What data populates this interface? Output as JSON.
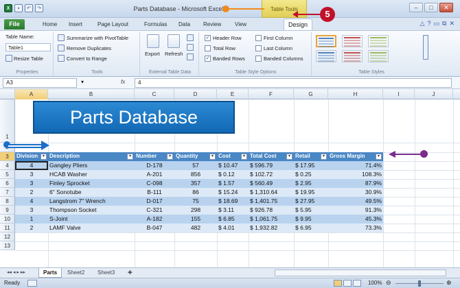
{
  "window": {
    "title": "Parts Database - Microsoft Excel",
    "contextual_tab_group": "Table Tools"
  },
  "ribbon_tabs": [
    "File",
    "Home",
    "Insert",
    "Page Layout",
    "Formulas",
    "Data",
    "Review",
    "View",
    "Design"
  ],
  "active_tab": "Design",
  "ribbon": {
    "properties": {
      "table_name_label": "Table Name:",
      "table_name_value": "Table1",
      "resize_label": "Resize Table",
      "caption": "Properties"
    },
    "tools": {
      "summarize": "Summarize with PivotTable",
      "remove_duplicates": "Remove Duplicates",
      "convert_to_range": "Convert to Range",
      "caption": "Tools"
    },
    "external": {
      "export": "Export",
      "refresh": "Refresh",
      "caption": "External Table Data"
    },
    "style_options": {
      "header_row": "Header Row",
      "total_row": "Total Row",
      "banded_rows": "Banded Rows",
      "first_column": "First Column",
      "last_column": "Last Column",
      "banded_columns": "Banded Columns",
      "caption": "Table Style Options",
      "checked": {
        "header_row": true,
        "total_row": false,
        "banded_rows": true,
        "first_column": false,
        "last_column": false,
        "banded_columns": false
      }
    },
    "table_styles": {
      "caption": "Table Styles",
      "swatch_colors": [
        "#4f81bd",
        "#c0504d",
        "#9bbb59",
        "#4f81bd",
        "#c0504d",
        "#9bbb59"
      ]
    }
  },
  "formula_bar": {
    "name_box": "A3",
    "fx": "fx",
    "value": "4"
  },
  "columns": [
    "A",
    "B",
    "C",
    "D",
    "E",
    "F",
    "G",
    "H",
    "I",
    "J"
  ],
  "rows": [
    "1",
    "2",
    "3",
    "4",
    "5",
    "6",
    "7",
    "8",
    "9",
    "10",
    "11",
    "12",
    "13"
  ],
  "banner_title": "Parts Database",
  "table": {
    "headers": [
      "Division",
      "Description",
      "Number",
      "Quantity",
      "Cost",
      "Total Cost",
      "Retail",
      "Gross Margin"
    ],
    "rows": [
      [
        "4",
        "Gangley Pliers",
        "D-178",
        "57",
        "$ 10.47",
        "$ 596.79",
        "$ 17.95",
        "71.4%"
      ],
      [
        "3",
        "HCAB Washer",
        "A-201",
        "856",
        "$ 0.12",
        "$ 102.72",
        "$ 0.25",
        "108.3%"
      ],
      [
        "3",
        "Finley Sprocket",
        "C-098",
        "357",
        "$ 1.57",
        "$ 560.49",
        "$ 2.95",
        "87.9%"
      ],
      [
        "2",
        "6\" Sonotube",
        "B-111",
        "86",
        "$ 15.24",
        "$ 1,310.64",
        "$ 19.95",
        "30.9%"
      ],
      [
        "4",
        "Langstrom 7\" Wrench",
        "D-017",
        "75",
        "$ 18.69",
        "$ 1,401.75",
        "$ 27.95",
        "49.5%"
      ],
      [
        "3",
        "Thompson Socket",
        "C-321",
        "298",
        "$ 3.11",
        "$ 926.78",
        "$ 5.95",
        "91.3%"
      ],
      [
        "1",
        "S-Joint",
        "A-182",
        "155",
        "$ 6.85",
        "$ 1,061.75",
        "$ 9.95",
        "45.3%"
      ],
      [
        "2",
        "LAMF Valve",
        "B-047",
        "482",
        "$ 4.01",
        "$ 1,932.82",
        "$ 6.95",
        "73.3%"
      ]
    ]
  },
  "callout": {
    "step_number": "5"
  },
  "sheet_tabs": [
    "Parts",
    "Sheet2",
    "Sheet3"
  ],
  "status": {
    "ready": "Ready",
    "zoom": "100%"
  }
}
